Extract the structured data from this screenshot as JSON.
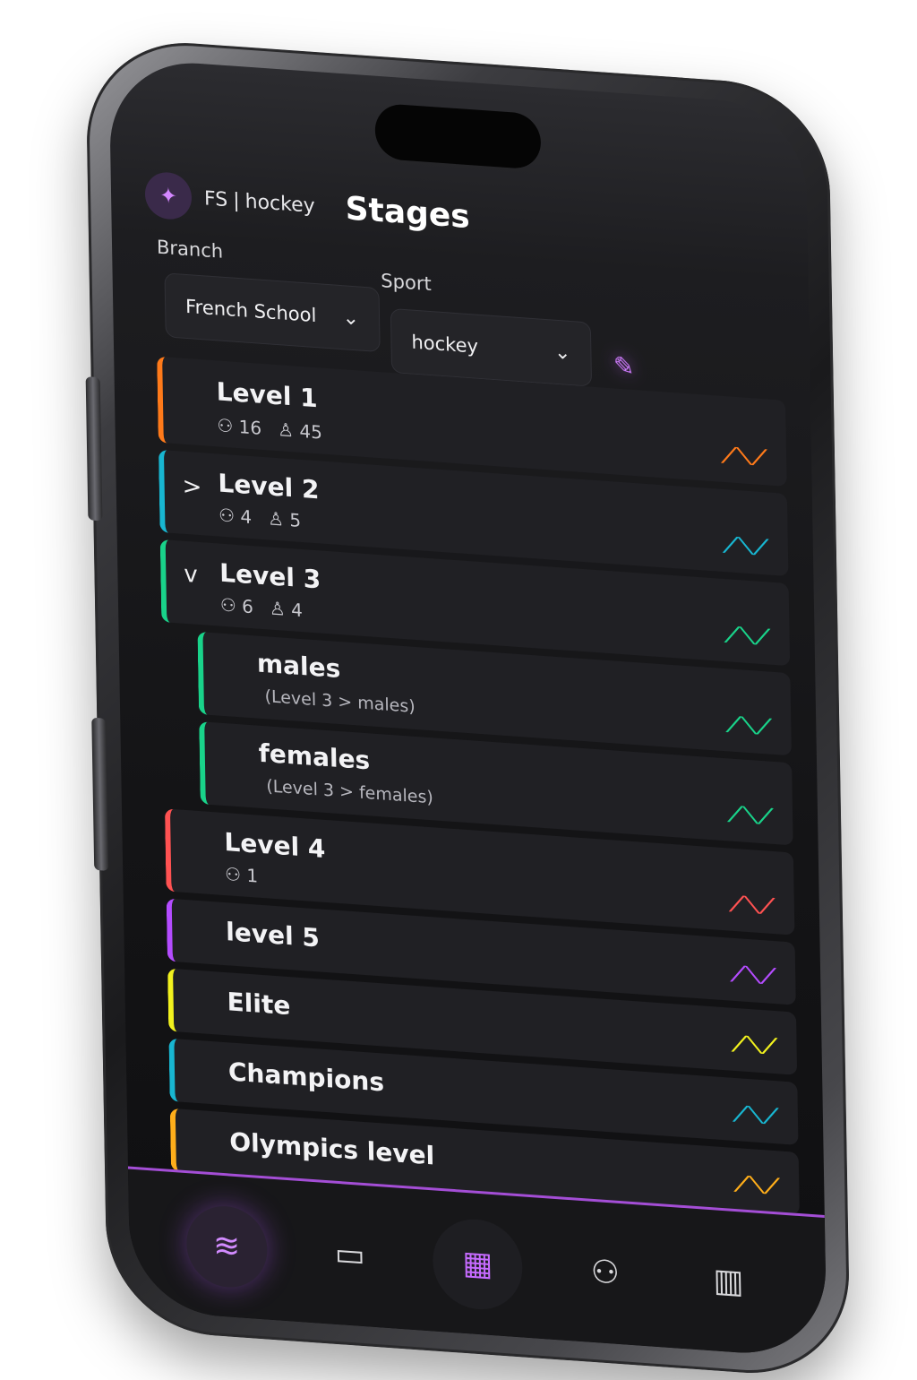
{
  "header": {
    "org": "FS",
    "sport": "hockey",
    "title": "Stages"
  },
  "filters": {
    "branch_label": "Branch",
    "branch_value": "French School",
    "sport_label": "Sport",
    "sport_value": "hockey"
  },
  "stages": [
    {
      "name": "Level 1",
      "groups": "16",
      "athletes": "45",
      "color": "#ff7a1a",
      "expander": ""
    },
    {
      "name": "Level 2",
      "groups": "4",
      "athletes": "5",
      "color": "#18b6d1",
      "expander": ">"
    },
    {
      "name": "Level 3",
      "groups": "6",
      "athletes": "4",
      "color": "#19d38a",
      "expander": "v"
    },
    {
      "name": "males",
      "path": "(Level 3 > males)",
      "color": "#19d38a"
    },
    {
      "name": "females",
      "path": "(Level 3 > females)",
      "color": "#19d38a"
    },
    {
      "name": "Level 4",
      "groups": "1",
      "color": "#ff5252"
    },
    {
      "name": "level 5",
      "color": "#b44cff"
    },
    {
      "name": "Elite",
      "color": "#f2f21e"
    },
    {
      "name": "Champions",
      "color": "#18b6d1"
    },
    {
      "name": "Olympics level",
      "color": "#ffae1a"
    }
  ],
  "tabs": [
    "stages",
    "folders",
    "dashboard",
    "users",
    "library"
  ]
}
